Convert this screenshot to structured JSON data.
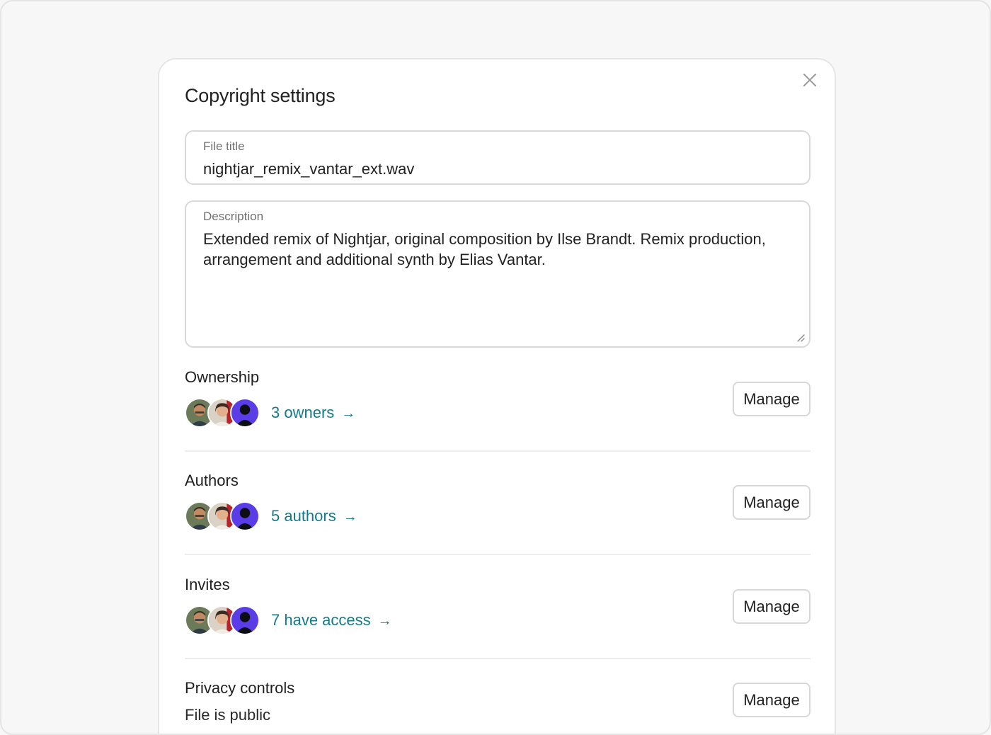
{
  "dialog": {
    "title": "Copyright settings",
    "close_icon": "close-icon"
  },
  "file_title": {
    "label": "File title",
    "value": "nightjar_remix_vantar_ext.wav"
  },
  "description": {
    "label": "Description",
    "value": "Extended remix of Nightjar, original composition by Ilse Brandt. Remix production, arrangement and additional synth by Elias Vantar."
  },
  "sections": {
    "ownership": {
      "name": "Ownership",
      "link": "3 owners",
      "button": "Manage"
    },
    "authors": {
      "name": "Authors",
      "link": "5 authors",
      "button": "Manage"
    },
    "invites": {
      "name": "Invites",
      "link": "7 have access",
      "button": "Manage"
    },
    "privacy": {
      "name": "Privacy controls",
      "status": "File is public",
      "button": "Manage"
    }
  },
  "colors": {
    "link": "#147a8a",
    "border": "#d9d9d9",
    "background": "#f7f7f7"
  }
}
